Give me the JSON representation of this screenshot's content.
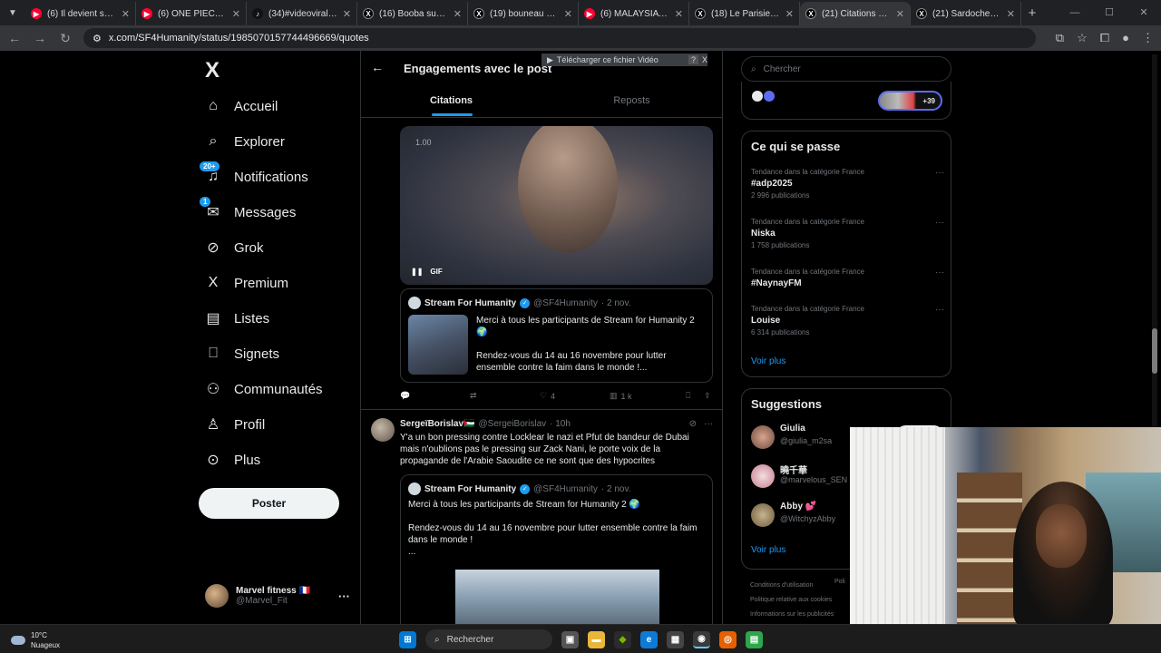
{
  "browser": {
    "tabs": [
      {
        "title": "(6) Il devient sportif d",
        "icon": "youtube-icon",
        "color": "#ff0033"
      },
      {
        "title": "(6) ONE PIECE : LA PR",
        "icon": "youtube-icon",
        "color": "#ff0033"
      },
      {
        "title": "(34)#videoviral #tikto",
        "icon": "tiktok-icon",
        "color": "#111111"
      },
      {
        "title": "(16) Booba sur X : \"@",
        "icon": "x-icon",
        "color": "#000000"
      },
      {
        "title": "(19) bouneau sur X : \"",
        "icon": "x-icon",
        "color": "#000000"
      },
      {
        "title": "(6) MALAYSIA AIRLIN",
        "icon": "youtube-icon",
        "color": "#ff0033"
      },
      {
        "title": "(18) Le Parisien sur X",
        "icon": "x-icon",
        "color": "#000000"
      },
      {
        "title": "(21) Citations de ce p",
        "icon": "x-icon",
        "color": "#000000",
        "active": true
      },
      {
        "title": "(21) Sardoche xx (@S",
        "icon": "x-icon",
        "color": "#000000"
      }
    ],
    "new_tab": "+",
    "url": "x.com/SF4Humanity/status/1985070157744496669/quotes"
  },
  "nav": {
    "logo": "X",
    "items": [
      {
        "label": "Accueil",
        "icon": "home-icon",
        "glyph": "⌂"
      },
      {
        "label": "Explorer",
        "icon": "search-icon",
        "glyph": "⌕"
      },
      {
        "label": "Notifications",
        "icon": "bell-icon",
        "glyph": "♫",
        "badge": "20+"
      },
      {
        "label": "Messages",
        "icon": "mail-icon",
        "glyph": "✉",
        "badge": "1"
      },
      {
        "label": "Grok",
        "icon": "grok-icon",
        "glyph": "⊘"
      },
      {
        "label": "Premium",
        "icon": "premium-x-icon",
        "glyph": "X"
      },
      {
        "label": "Listes",
        "icon": "list-icon",
        "glyph": "▤"
      },
      {
        "label": "Signets",
        "icon": "bookmark-icon",
        "glyph": "⎕"
      },
      {
        "label": "Communautés",
        "icon": "communities-icon",
        "glyph": "⚇"
      },
      {
        "label": "Profil",
        "icon": "profile-icon",
        "glyph": "♙"
      },
      {
        "label": "Plus",
        "icon": "more-circle-icon",
        "glyph": "⊙"
      }
    ],
    "post_button": "Poster",
    "account": {
      "name": "Marvel fitness 🇫🇷",
      "handle": "@Marvel_Fit"
    }
  },
  "main": {
    "title": "Engagements avec le post",
    "download_overlay": "Télécharger ce fichier Vidéo",
    "download_help": "?",
    "download_close": "X",
    "tabs": {
      "quotes": "Citations",
      "reposts": "Reposts"
    },
    "post1": {
      "gif_time": "1.00",
      "gif_label": "GIF",
      "quote": {
        "name": "Stream For Humanity",
        "handle": "@SF4Humanity",
        "date": "· 2 nov.",
        "text1": "Merci à tous les participants de Stream for Humanity 2 🌍",
        "text2": "Rendez-vous du 14 au 16 novembre pour lutter ensemble contre la faim dans le monde !..."
      },
      "likes": "4",
      "views": "1 k"
    },
    "post2": {
      "name": "SergeïBorislav🇵🇸",
      "handle": "@SergeiBorislav",
      "time": "· 10h",
      "text": "Y'a un bon pressing contre Locklear le nazi et Pfut de bandeur de Dubai mais n'oublions pas le pressing sur Zack Nani, le porte voix de la propagande de l'Arabie Saoudite ce ne sont que des hypocrites",
      "quote": {
        "name": "Stream For Humanity",
        "handle": "@SF4Humanity",
        "date": "· 2 nov.",
        "text1": "Merci à tous les participants de Stream for Humanity 2 🌍",
        "text2": "Rendez-vous du 14 au 16 novembre pour lutter ensemble contre la faim dans le monde !",
        "text3": "..."
      }
    }
  },
  "right": {
    "search_placeholder": "Chercher",
    "plus_count": "+39",
    "trends_title": "Ce qui se passe",
    "trends": [
      {
        "category": "Tendance dans la catégorie France",
        "name": "#adp2025",
        "count": "2 996 publications"
      },
      {
        "category": "Tendance dans la catégorie France",
        "name": "Niska",
        "count": "1 758 publications"
      },
      {
        "category": "Tendance dans la catégorie France",
        "name": "#NaynayFM",
        "count": ""
      },
      {
        "category": "Tendance dans la catégorie France",
        "name": "Louise",
        "count": "6 314 publications"
      }
    ],
    "see_more": "Voir plus",
    "suggestions_title": "Suggestions",
    "suggestions": [
      {
        "name": "Giulia",
        "handle": "@giulia_m2sa",
        "button": "Suivre"
      },
      {
        "name": "曉千華",
        "handle": "@marvelous_SEN",
        "button": "Suivre"
      },
      {
        "name": "Abby 💕",
        "handle": "@WitchyzAbby",
        "button": ""
      }
    ],
    "see_more2": "Voir plus",
    "footer": [
      "Conditions d'utilisation",
      "Politique relative aux cookies",
      "Informations sur les publicités"
    ],
    "footer_partial": "Poli"
  },
  "taskbar": {
    "temp": "10°C",
    "weather": "Nuageux",
    "search": "Rechercher"
  }
}
